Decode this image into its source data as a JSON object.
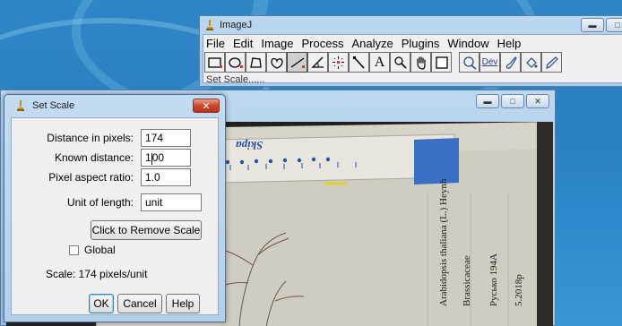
{
  "main_window": {
    "title": "ImageJ",
    "menu": [
      "File",
      "Edit",
      "Image",
      "Process",
      "Analyze",
      "Plugins",
      "Window",
      "Help"
    ],
    "tools": [
      {
        "name": "rectangle-tool-icon"
      },
      {
        "name": "oval-tool-icon"
      },
      {
        "name": "polygon-tool-icon"
      },
      {
        "name": "freehand-tool-icon"
      },
      {
        "name": "line-tool-icon",
        "selected": true
      },
      {
        "name": "angle-tool-icon"
      },
      {
        "name": "point-tool-icon"
      },
      {
        "name": "wand-tool-icon"
      },
      {
        "name": "text-tool-icon",
        "glyph": "A"
      },
      {
        "name": "magnifier-tool-icon"
      },
      {
        "name": "hand-tool-icon"
      },
      {
        "name": "color-picker-tool-icon"
      },
      {
        "name": "zoom-tool-icon"
      },
      {
        "name": "dev-tool-icon",
        "glyph": "Dev"
      },
      {
        "name": "brush-tool-icon"
      },
      {
        "name": "flood-fill-tool-icon"
      },
      {
        "name": "pencil-tool-icon"
      }
    ],
    "status": "Set Scale......"
  },
  "image_window": {
    "labels": {
      "ruler_brand": "Skipa",
      "species": "Arabidopsis thaliana (L.) Heynh",
      "family": "Brassicaceae",
      "collector": "Русько 194А",
      "date": "5.2018р"
    }
  },
  "dialog": {
    "title": "Set Scale",
    "fields": [
      {
        "label": "Distance in pixels:",
        "value": "174"
      },
      {
        "label": "Known distance:",
        "value_before_caret": "1",
        "value_after_caret": "00"
      },
      {
        "label": "Pixel aspect ratio:",
        "value": "1.0"
      },
      {
        "label": "Unit of length:",
        "value": "unit"
      }
    ],
    "remove_scale_label": "Click to Remove Scale",
    "global_label": "Global",
    "global_checked": false,
    "scale_text": "Scale: 174 pixels/unit",
    "ok_label": "OK",
    "cancel_label": "Cancel",
    "help_label": "Help"
  },
  "colors": {
    "desktop": "#2a7fc0",
    "titlebar": "#bcd7ef",
    "close": "#c9472c",
    "ruler_mark": "#2b4fa8"
  }
}
